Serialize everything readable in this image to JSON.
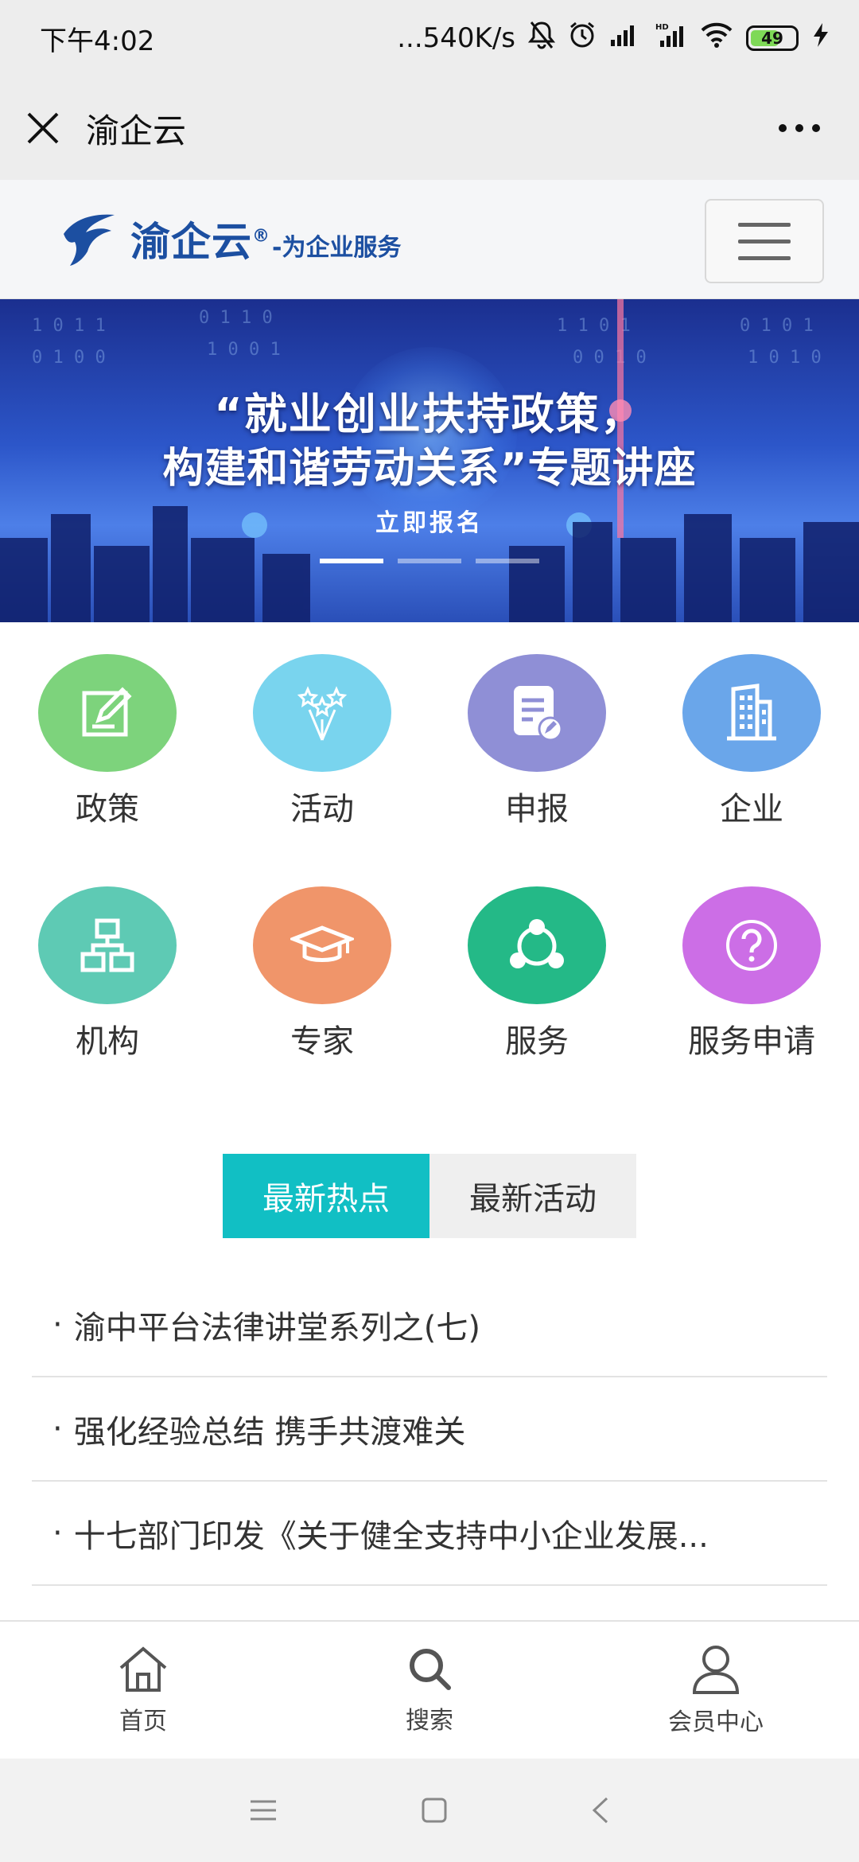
{
  "status_bar": {
    "time": "下午4:02",
    "network_speed": "...540K/s",
    "signal_label": "HD",
    "battery_level": "49"
  },
  "titlebar": {
    "title": "渝企云"
  },
  "site_header": {
    "logo_name": "渝企云",
    "logo_registered": "®",
    "logo_slogan": "-为企业服务"
  },
  "banner": {
    "line1": "“就业创业扶持政策，",
    "line2": "构建和谐劳动关系”专题讲座",
    "cta": "立即报名",
    "slide_count": 3,
    "active_slide": 1
  },
  "grid": [
    {
      "label": "政策",
      "color": "#7dd37c",
      "icon": "policy-edit-icon"
    },
    {
      "label": "活动",
      "color": "#79d4ee",
      "icon": "fireworks-icon"
    },
    {
      "label": "申报",
      "color": "#8f8fd6",
      "icon": "document-edit-icon"
    },
    {
      "label": "企业",
      "color": "#6aa6ea",
      "icon": "building-icon"
    },
    {
      "label": "机构",
      "color": "#5ecab4",
      "icon": "org-chart-icon"
    },
    {
      "label": "专家",
      "color": "#f0956a",
      "icon": "graduation-cap-icon"
    },
    {
      "label": "服务",
      "color": "#24b987",
      "icon": "network-icon"
    },
    {
      "label": "服务申请",
      "color": "#cc6ee6",
      "icon": "question-icon"
    }
  ],
  "tabs": [
    {
      "label": "最新热点",
      "active": true
    },
    {
      "label": "最新活动",
      "active": false
    }
  ],
  "news": [
    "渝中平台法律讲堂系列之(七)",
    "强化经验总结 携手共渡难关",
    "十七部门印发《关于健全支持中小企业发展..."
  ],
  "bottom_nav": [
    {
      "label": "首页",
      "icon": "home-icon"
    },
    {
      "label": "搜索",
      "icon": "search-icon"
    },
    {
      "label": "会员中心",
      "icon": "user-icon"
    }
  ],
  "colors": {
    "accent": "#11bfc4",
    "brand": "#1c4fa1"
  }
}
